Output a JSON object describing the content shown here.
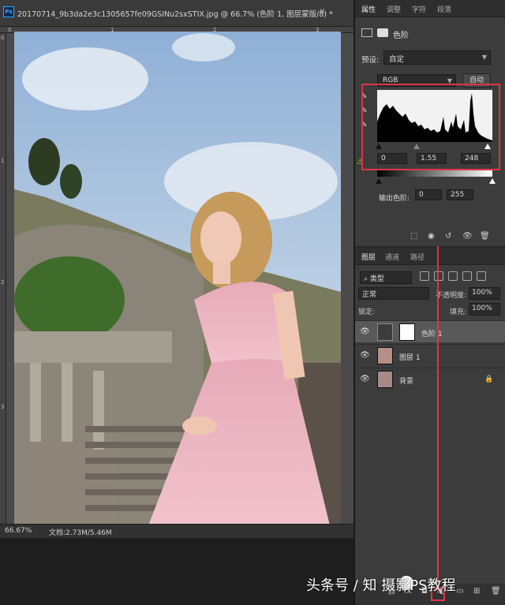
{
  "document": {
    "title": "20170714_9b3da2e3c1305657fe09GSINu2sxSTIX.jpg @ 66.7% (色阶 1, 图层蒙版/8) *",
    "zoom": "66.67%",
    "doc_size": "文档:2.73M/5.46M",
    "ruler_top": [
      "0",
      "1",
      "2",
      "3"
    ],
    "ruler_left": [
      "0",
      "1",
      "2",
      "3"
    ]
  },
  "properties_panel": {
    "tabs": [
      "属性",
      "调整",
      "字符",
      "段落"
    ],
    "header_title": "色阶",
    "preset_label": "预设:",
    "preset_value": "自定",
    "channel_value": "RGB",
    "auto_label": "自动",
    "input_black": "0",
    "input_gamma": "1.55",
    "input_white": "248",
    "output_label": "输出色阶:",
    "output_black": "0",
    "output_white": "255"
  },
  "layers_panel": {
    "tabs": [
      "图层",
      "通道",
      "路径"
    ],
    "kind_label": "类型",
    "blend_mode": "正常",
    "opacity_label": "不透明度:",
    "opacity_value": "100%",
    "lock_label": "锁定:",
    "fill_label": "填充:",
    "fill_value": "100%",
    "layers": [
      {
        "name": "色阶 1",
        "type": "adjustment",
        "selected": true
      },
      {
        "name": "图层 1",
        "type": "image",
        "selected": false
      },
      {
        "name": "背景",
        "type": "image",
        "locked": true,
        "selected": false
      }
    ]
  },
  "watermarks": {
    "bottom": "头条号 / 知   摄影PS教程"
  },
  "colors": {
    "highlight": "#e0344a",
    "panel_bg": "#3c3c3c",
    "app_bg": "#282828"
  }
}
